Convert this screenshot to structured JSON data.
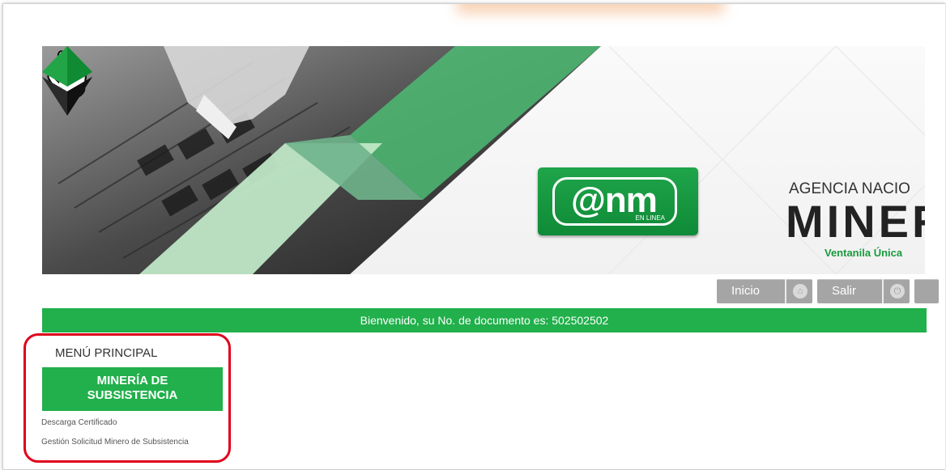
{
  "colors": {
    "accent_green": "#21b04b",
    "highlight_red": "#e0001b",
    "nav_gray": "#a5a5a5"
  },
  "logo": {
    "text": "@nm",
    "subtext": "EN LINEA"
  },
  "agency": {
    "name_line": "AGENCIA NACIO",
    "big_line": "MINER",
    "tagline": "Ventanila Única"
  },
  "nav": {
    "inicio_label": "Inicio",
    "inicio_icon": "home-icon",
    "salir_label": "Salir",
    "salir_icon": "power-icon"
  },
  "welcome_text": "Bienvenido, su No. de documento es: 502502502",
  "menu": {
    "title": "MENÚ PRINCIPAL",
    "section_line1": "MINERÍA DE",
    "section_line2": "SUBSISTENCIA",
    "links": [
      "Descarga Certificado",
      "Gestión Solicitud Minero de Subsistencia"
    ]
  }
}
